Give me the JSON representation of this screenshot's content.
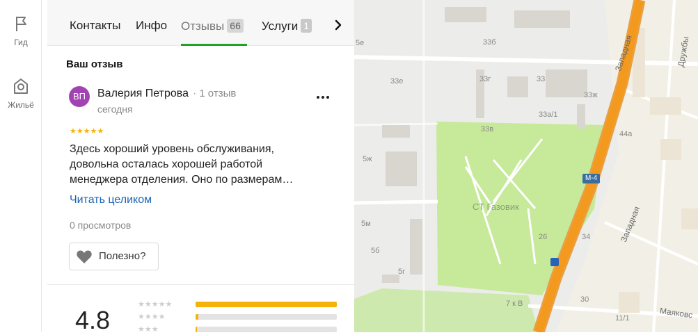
{
  "rail": {
    "guide_label": "Гид",
    "housing_label": "Жильё"
  },
  "tabs": [
    {
      "label": "Контакты"
    },
    {
      "label": "Инфо"
    },
    {
      "label": "Отзывы",
      "count": "66"
    },
    {
      "label": "Услуги",
      "count": "1"
    }
  ],
  "section_title": "Ваш отзыв",
  "review": {
    "avatar_initials": "ВП",
    "author": "Валерия Петрова",
    "author_reviews": "1 отзыв",
    "date": "сегодня",
    "stars": "★★★★★",
    "text": "Здесь хороший уровень обслуживания, довольна осталась хорошей работой менеджера отделения. Оно по размерам…",
    "read_more": "Читать целиком",
    "views": "0 просмотров",
    "useful_label": "Полезно?"
  },
  "summary": {
    "rating": "4.8",
    "histogram": [
      {
        "stars": "★★★★★",
        "fraction": 1.0
      },
      {
        "stars": "★★★★",
        "fraction": 0.02
      },
      {
        "stars": "★★★",
        "fraction": 0.01
      }
    ]
  },
  "map": {
    "labels": [
      "5е",
      "33б",
      "33е",
      "33г",
      "33",
      "33ж",
      "33а/1",
      "33в",
      "5ж",
      "5м",
      "5б",
      "5г",
      "26",
      "34",
      "44а",
      "7 к В",
      "30",
      "11/1"
    ],
    "area_label": "СТ Газовик",
    "streets": [
      "Западная",
      "Западная",
      "Дружбы",
      "Маяковс"
    ],
    "highway_shield": "М-4"
  },
  "colors": {
    "accent_green": "#1fa12a",
    "link_blue": "#1a64b6",
    "star_gold": "#f5b30a",
    "highway_orange": "#f39a1e",
    "park_green": "#c6e99a"
  }
}
